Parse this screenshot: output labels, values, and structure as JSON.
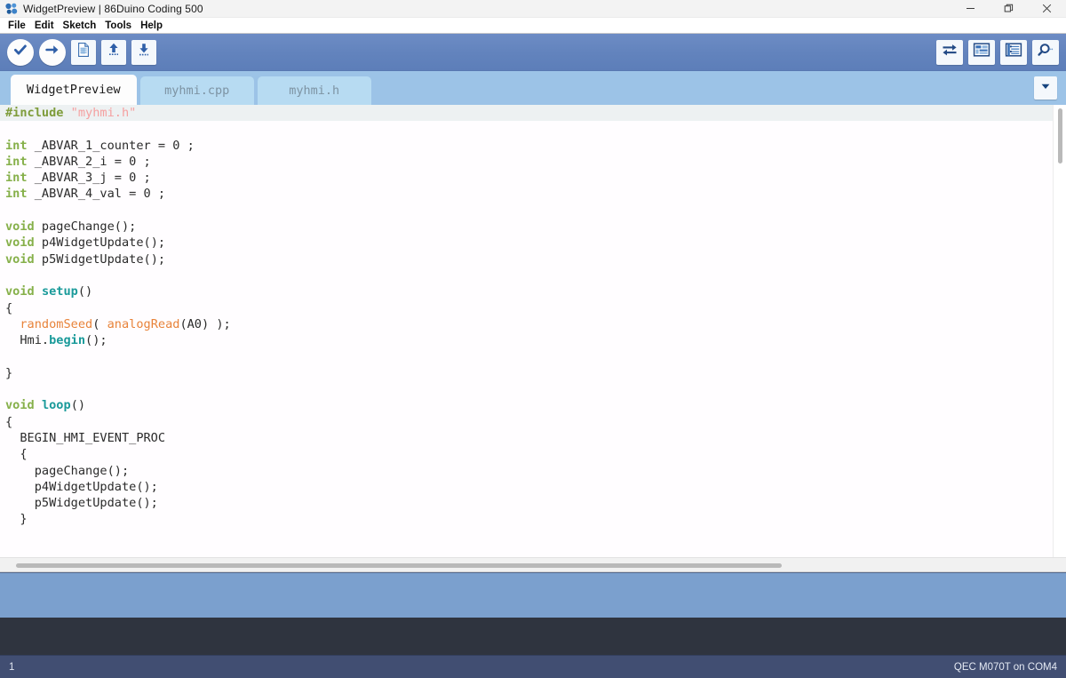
{
  "window": {
    "title": "WidgetPreview | 86Duino Coding 500",
    "app_icon": "molecule-icon",
    "controls": {
      "minimize": "minimize-icon",
      "restore": "restore-icon",
      "close": "close-icon"
    }
  },
  "menubar": {
    "items": [
      {
        "label": "File"
      },
      {
        "label": "Edit"
      },
      {
        "label": "Sketch"
      },
      {
        "label": "Tools"
      },
      {
        "label": "Help"
      }
    ]
  },
  "toolbar": {
    "left": [
      {
        "name": "verify-button",
        "icon": "checkmark-icon",
        "tooltip": "Verify"
      },
      {
        "name": "upload-button",
        "icon": "arrow-right-icon",
        "tooltip": "Upload"
      },
      {
        "name": "new-button",
        "icon": "new-file-icon",
        "tooltip": "New"
      },
      {
        "name": "open-button",
        "icon": "arrow-up-icon",
        "tooltip": "Open"
      },
      {
        "name": "save-button",
        "icon": "arrow-down-icon",
        "tooltip": "Save"
      }
    ],
    "right": [
      {
        "name": "serial-monitor-button",
        "icon": "exchange-arrows-icon",
        "tooltip": "Serial Monitor"
      },
      {
        "name": "hmi-designer-button",
        "icon": "layout-grid-icon",
        "tooltip": "HMI Designer"
      },
      {
        "name": "widget-list-button",
        "icon": "list-panel-icon",
        "tooltip": "Widget List"
      },
      {
        "name": "search-button",
        "icon": "magnifier-icon",
        "tooltip": "Search"
      }
    ]
  },
  "tabs": {
    "items": [
      {
        "label": "WidgetPreview",
        "active": true
      },
      {
        "label": "myhmi.cpp",
        "active": false
      },
      {
        "label": "myhmi.h",
        "active": false
      }
    ],
    "dropdown_icon": "chevron-down-icon"
  },
  "editor": {
    "current_line": 1,
    "lines": [
      [
        {
          "t": "#include ",
          "c": "k-pre"
        },
        {
          "t": "\"myhmi.h\"",
          "c": "k-str"
        }
      ],
      [],
      [
        {
          "t": "int",
          "c": "k-type"
        },
        {
          "t": " _ABVAR_1_counter = 0 ;",
          "c": "k-plain"
        }
      ],
      [
        {
          "t": "int",
          "c": "k-type"
        },
        {
          "t": " _ABVAR_2_i = 0 ;",
          "c": "k-plain"
        }
      ],
      [
        {
          "t": "int",
          "c": "k-type"
        },
        {
          "t": " _ABVAR_3_j = 0 ;",
          "c": "k-plain"
        }
      ],
      [
        {
          "t": "int",
          "c": "k-type"
        },
        {
          "t": " _ABVAR_4_val = 0 ;",
          "c": "k-plain"
        }
      ],
      [],
      [
        {
          "t": "void",
          "c": "k-type"
        },
        {
          "t": " pageChange();",
          "c": "k-plain"
        }
      ],
      [
        {
          "t": "void",
          "c": "k-type"
        },
        {
          "t": " p4WidgetUpdate();",
          "c": "k-plain"
        }
      ],
      [
        {
          "t": "void",
          "c": "k-type"
        },
        {
          "t": " p5WidgetUpdate();",
          "c": "k-plain"
        }
      ],
      [],
      [
        {
          "t": "void",
          "c": "k-type"
        },
        {
          "t": " ",
          "c": "k-plain"
        },
        {
          "t": "setup",
          "c": "k-fn"
        },
        {
          "t": "()",
          "c": "k-plain"
        }
      ],
      [
        {
          "t": "{",
          "c": "k-plain"
        }
      ],
      [
        {
          "t": "  ",
          "c": "k-plain"
        },
        {
          "t": "randomSeed",
          "c": "k-call"
        },
        {
          "t": "( ",
          "c": "k-plain"
        },
        {
          "t": "analogRead",
          "c": "k-call"
        },
        {
          "t": "(A0) );",
          "c": "k-plain"
        }
      ],
      [
        {
          "t": "  Hmi.",
          "c": "k-plain"
        },
        {
          "t": "begin",
          "c": "k-fn"
        },
        {
          "t": "();",
          "c": "k-plain"
        }
      ],
      [],
      [
        {
          "t": "}",
          "c": "k-plain"
        }
      ],
      [],
      [
        {
          "t": "void",
          "c": "k-type"
        },
        {
          "t": " ",
          "c": "k-plain"
        },
        {
          "t": "loop",
          "c": "k-fn"
        },
        {
          "t": "()",
          "c": "k-plain"
        }
      ],
      [
        {
          "t": "{",
          "c": "k-plain"
        }
      ],
      [
        {
          "t": "  BEGIN_HMI_EVENT_PROC",
          "c": "k-plain"
        }
      ],
      [
        {
          "t": "  {",
          "c": "k-plain"
        }
      ],
      [
        {
          "t": "    pageChange();",
          "c": "k-plain"
        }
      ],
      [
        {
          "t": "    p4WidgetUpdate();",
          "c": "k-plain"
        }
      ],
      [
        {
          "t": "    p5WidgetUpdate();",
          "c": "k-plain"
        }
      ],
      [
        {
          "t": "  }",
          "c": "k-plain"
        }
      ]
    ]
  },
  "console": {
    "text": ""
  },
  "statusbar": {
    "line_number": "1",
    "board_info": "QEC M070T on COM4"
  },
  "colors": {
    "toolbar": "#6283bd",
    "tabstrip": "#9cc3e7",
    "tab_inactive": "#b7dbf2",
    "message_bar": "#7ba0ce",
    "console": "#2f343f",
    "statusbar": "#414e72",
    "keyword": "#86b04a",
    "function": "#1a9a9a",
    "call": "#e8833a",
    "string": "#f5a0a0",
    "preprocessor": "#7e9c3a"
  }
}
